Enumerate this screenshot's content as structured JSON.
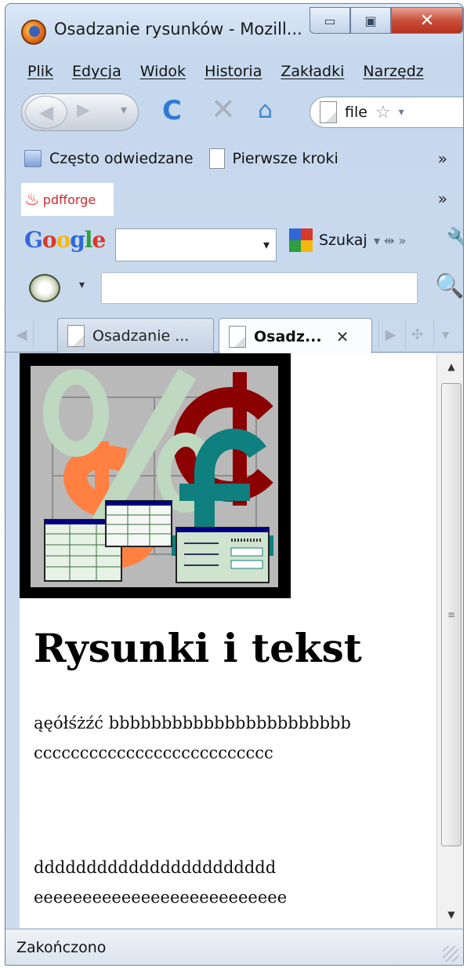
{
  "window": {
    "title": "Osadzanie rysunków - Mozill...",
    "min_glyph": "▭",
    "max_glyph": "▣",
    "close_glyph": "✕"
  },
  "menubar": {
    "items": [
      "Plik",
      "Edycja",
      "Widok",
      "Historia",
      "Zakładki",
      "Narzędz"
    ]
  },
  "navbar": {
    "back_glyph": "◀",
    "forward_glyph": "▶",
    "dropdown_glyph": "▾",
    "reload_glyph": "C",
    "stop_glyph": "✕",
    "home_glyph": "⌂",
    "url_text": "file",
    "star_glyph": "☆",
    "url_dropdown_glyph": "▾"
  },
  "bookmarks": {
    "items": [
      "Często odwiedzane",
      "Pierwsze kroki"
    ],
    "overflow": "»"
  },
  "pdfforge": {
    "logo_text": "pdfforge",
    "overflow": "»"
  },
  "googlebar": {
    "logo_letters": [
      "G",
      "o",
      "o",
      "g",
      "l",
      "e"
    ],
    "search_value": "",
    "search_dropdown": "▾",
    "search_button": "Szukaj",
    "extra": "▾ ⇹ »",
    "wrench_glyph": "🔧"
  },
  "extrabar": {
    "dropdown": "▾",
    "input_value": "",
    "search_glyph": "🔍"
  },
  "tabs": [
    {
      "label": "Osadzanie ...",
      "active": false
    },
    {
      "label": "Osadz...",
      "active": true,
      "close": "✕"
    }
  ],
  "tab_controls": {
    "scroll_left": "◀",
    "scroll_right": "▶",
    "list": "✣",
    "menu": "▾"
  },
  "page": {
    "heading": "Rysunki i tekst",
    "para1": [
      "ąęółśżźć bbbbbbbbbbbbbbbbbbbbbbb",
      "cccccccccccccccccccccccccc"
    ],
    "para2": [
      "ddddddddddddddddddddddd",
      "eeeeeeeeeeeeeeeeeeeeeeeeee"
    ]
  },
  "scrollbar": {
    "up": "▲",
    "down": "▼",
    "grip": "≡",
    "thumb_fraction": 0.9
  },
  "status": {
    "text": "Zakończono"
  },
  "colors": {
    "accent_blue": "#2f7ad4",
    "close_red": "#c8503c",
    "picture_bg": "#b9b9b9"
  }
}
